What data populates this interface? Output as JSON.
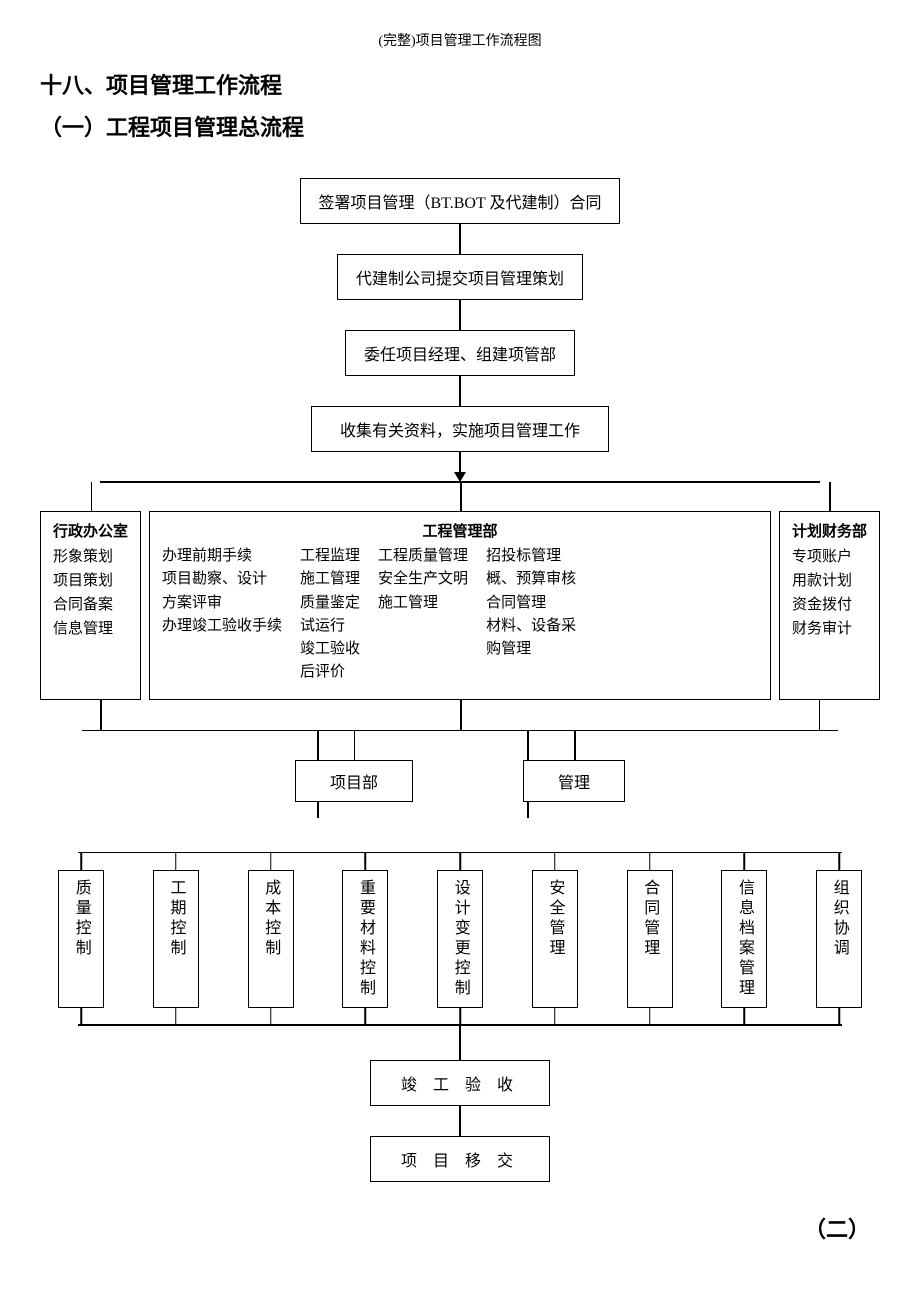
{
  "header": "(完整)项目管理工作流程图",
  "title1": "十八、项目管理工作流程",
  "title2": "（一）工程项目管理总流程",
  "top_steps": [
    "签署项目管理（BT.BOT 及代建制）合同",
    "代建制公司提交项目管理策划",
    "委任项目经理、组建项管部",
    "收集有关资料，实施项目管理工作"
  ],
  "departments": {
    "left": {
      "title": "行政办公室",
      "items": [
        "形象策划",
        "项目策划",
        "合同备案",
        "信息管理"
      ]
    },
    "center": {
      "title": "工程管理部",
      "col1": [
        "办理前期手续",
        "项目勘察、设计",
        "方案评审",
        "办理竣工验收手续"
      ],
      "col2": [
        "工程监理",
        "施工管理",
        "质量鉴定",
        "试运行",
        "竣工验收",
        "后评价"
      ],
      "col3": [
        "工程质量管理",
        "安全生产文明",
        "施工管理"
      ],
      "col4": [
        "招投标管理",
        "概、预算审核",
        "合同管理",
        "材料、设备采",
        "购管理"
      ]
    },
    "right": {
      "title": "计划财务部",
      "items": [
        "专项账户",
        "用款计划",
        "资金拨付",
        "财务审计"
      ]
    }
  },
  "pm_row": {
    "left": "项目部",
    "right": "管理"
  },
  "controls": [
    "质量控制",
    "工期控制",
    "成本控制",
    "重要材料控制",
    "设计变更控制",
    "安全管理",
    "合同管理",
    "信息档案管理",
    "组织协调"
  ],
  "final": {
    "accept": "竣 工 验 收",
    "handover": "项 目 移 交"
  },
  "next_section": "（二）",
  "chart_data": {
    "type": "flowchart",
    "nodes": [
      {
        "id": "n1",
        "label": "签署项目管理（BT.BOT 及代建制）合同"
      },
      {
        "id": "n2",
        "label": "代建制公司提交项目管理策划"
      },
      {
        "id": "n3",
        "label": "委任项目经理、组建项管部"
      },
      {
        "id": "n4",
        "label": "收集有关资料，实施项目管理工作"
      },
      {
        "id": "d1",
        "label": "行政办公室",
        "children": [
          "形象策划",
          "项目策划",
          "合同备案",
          "信息管理"
        ]
      },
      {
        "id": "d2",
        "label": "工程管理部",
        "children": [
          "办理前期手续",
          "项目勘察、设计",
          "方案评审",
          "办理竣工验收手续",
          "工程监理",
          "施工管理",
          "质量鉴定",
          "试运行",
          "竣工验收",
          "后评价",
          "工程质量管理",
          "安全生产文明",
          "施工管理",
          "招投标管理",
          "概、预算审核",
          "合同管理",
          "材料、设备采购管理"
        ]
      },
      {
        "id": "d3",
        "label": "计划财务部",
        "children": [
          "专项账户",
          "用款计划",
          "资金拨付",
          "财务审计"
        ]
      },
      {
        "id": "p1",
        "label": "项目部"
      },
      {
        "id": "p2",
        "label": "管理"
      },
      {
        "id": "c1",
        "label": "质量控制"
      },
      {
        "id": "c2",
        "label": "工期控制"
      },
      {
        "id": "c3",
        "label": "成本控制"
      },
      {
        "id": "c4",
        "label": "重要材料控制"
      },
      {
        "id": "c5",
        "label": "设计变更控制"
      },
      {
        "id": "c6",
        "label": "安全管理"
      },
      {
        "id": "c7",
        "label": "合同管理"
      },
      {
        "id": "c8",
        "label": "信息档案管理"
      },
      {
        "id": "c9",
        "label": "组织协调"
      },
      {
        "id": "f1",
        "label": "竣工验收"
      },
      {
        "id": "f2",
        "label": "项目移交"
      }
    ],
    "edges": [
      [
        "n1",
        "n2"
      ],
      [
        "n2",
        "n3"
      ],
      [
        "n3",
        "n4"
      ],
      [
        "n4",
        "d1"
      ],
      [
        "n4",
        "d2"
      ],
      [
        "n4",
        "d3"
      ],
      [
        "d1",
        "p1"
      ],
      [
        "d2",
        "p1"
      ],
      [
        "d2",
        "p2"
      ],
      [
        "d3",
        "p2"
      ],
      [
        "p1",
        "c1"
      ],
      [
        "p1",
        "c2"
      ],
      [
        "p1",
        "c3"
      ],
      [
        "p1",
        "c4"
      ],
      [
        "p1",
        "c5"
      ],
      [
        "p2",
        "c6"
      ],
      [
        "p2",
        "c7"
      ],
      [
        "p2",
        "c8"
      ],
      [
        "p2",
        "c9"
      ],
      [
        "c1",
        "f1"
      ],
      [
        "c2",
        "f1"
      ],
      [
        "c3",
        "f1"
      ],
      [
        "c4",
        "f1"
      ],
      [
        "c5",
        "f1"
      ],
      [
        "c6",
        "f1"
      ],
      [
        "c7",
        "f1"
      ],
      [
        "c8",
        "f1"
      ],
      [
        "c9",
        "f1"
      ],
      [
        "f1",
        "f2"
      ]
    ]
  }
}
